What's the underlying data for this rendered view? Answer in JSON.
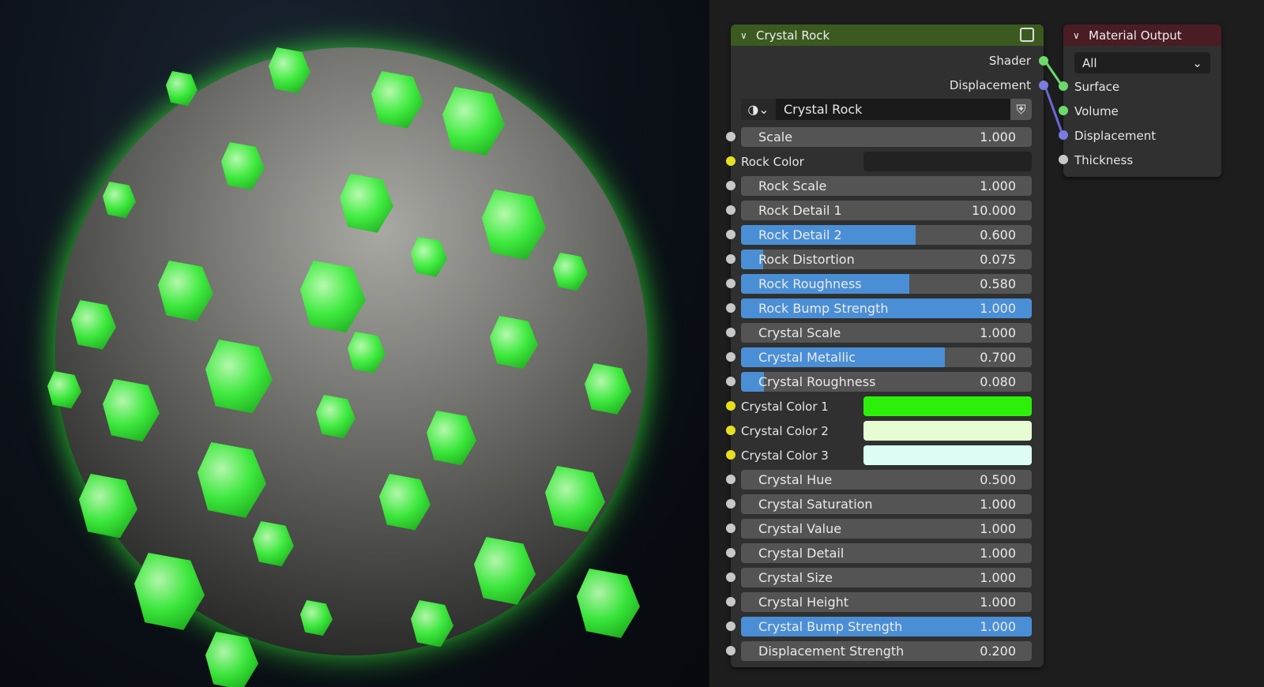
{
  "node_group": {
    "title": "Crystal Rock",
    "outputs": [
      "Shader",
      "Displacement"
    ],
    "datablock_name": "Crystal Rock",
    "inputs": [
      {
        "label": "Scale",
        "value": "1.000",
        "type": "value",
        "fill": 0,
        "socket": "#c8c8c8"
      },
      {
        "label": "Rock Color",
        "type": "color",
        "color": "#222222",
        "socket": "#e6e020"
      },
      {
        "label": "Rock Scale",
        "value": "1.000",
        "type": "value",
        "fill": 0,
        "socket": "#c8c8c8"
      },
      {
        "label": "Rock Detail 1",
        "value": "10.000",
        "type": "value",
        "fill": 0,
        "socket": "#c8c8c8"
      },
      {
        "label": "Rock Detail 2",
        "value": "0.600",
        "type": "factor",
        "fill": 0.6,
        "socket": "#c8c8c8"
      },
      {
        "label": "Rock Distortion",
        "value": "0.075",
        "type": "factor",
        "fill": 0.075,
        "socket": "#c8c8c8"
      },
      {
        "label": "Rock Roughness",
        "value": "0.580",
        "type": "factor",
        "fill": 0.58,
        "socket": "#c8c8c8"
      },
      {
        "label": "Rock Bump Strength",
        "value": "1.000",
        "type": "factor",
        "fill": 1,
        "socket": "#c8c8c8"
      },
      {
        "label": "Crystal Scale",
        "value": "1.000",
        "type": "value",
        "fill": 0,
        "socket": "#c8c8c8"
      },
      {
        "label": "Crystal Metallic",
        "value": "0.700",
        "type": "factor",
        "fill": 0.7,
        "socket": "#c8c8c8"
      },
      {
        "label": "Crystal Roughness",
        "value": "0.080",
        "type": "factor",
        "fill": 0.08,
        "socket": "#c8c8c8"
      },
      {
        "label": "Crystal Color 1",
        "type": "color",
        "color": "#2df00a",
        "socket": "#e6e020"
      },
      {
        "label": "Crystal Color 2",
        "type": "color",
        "color": "#e6fcd2",
        "socket": "#e6e020"
      },
      {
        "label": "Crystal Color 3",
        "type": "color",
        "color": "#dcfcf4",
        "socket": "#e6e020"
      },
      {
        "label": "Crystal Hue",
        "value": "0.500",
        "type": "value",
        "fill": 0,
        "socket": "#c8c8c8"
      },
      {
        "label": "Crystal Saturation",
        "value": "1.000",
        "type": "value",
        "fill": 0,
        "socket": "#c8c8c8"
      },
      {
        "label": "Crystal Value",
        "value": "1.000",
        "type": "value",
        "fill": 0,
        "socket": "#c8c8c8"
      },
      {
        "label": "Crystal Detail",
        "value": "1.000",
        "type": "value",
        "fill": 0,
        "socket": "#c8c8c8"
      },
      {
        "label": "Crystal Size",
        "value": "1.000",
        "type": "value",
        "fill": 0,
        "socket": "#c8c8c8"
      },
      {
        "label": "Crystal Height",
        "value": "1.000",
        "type": "value",
        "fill": 0,
        "socket": "#c8c8c8"
      },
      {
        "label": "Crystal Bump Strength",
        "value": "1.000",
        "type": "factor",
        "fill": 1,
        "socket": "#c8c8c8"
      },
      {
        "label": "Displacement Strength",
        "value": "0.200",
        "type": "value",
        "fill": 0,
        "socket": "#c8c8c8"
      }
    ]
  },
  "material_output": {
    "title": "Material Output",
    "target": "All",
    "inputs": [
      "Surface",
      "Volume",
      "Displacement",
      "Thickness"
    ]
  },
  "colors": {
    "group_header": "#3b5a1f",
    "output_header": "#4a1c24",
    "shader_socket": "#6cd96c",
    "vector_socket": "#7b7be0",
    "accent": "#4a8fd6"
  }
}
